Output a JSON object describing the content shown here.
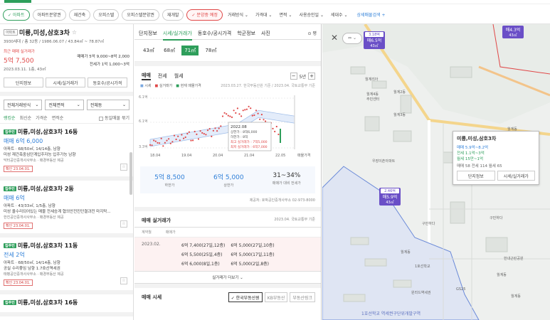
{
  "filters": {
    "items": [
      {
        "label": "✓ 아파트",
        "style": "green"
      },
      {
        "label": "아파트분양권",
        "style": ""
      },
      {
        "label": "재건축",
        "style": ""
      },
      {
        "label": "오피스텔",
        "style": ""
      },
      {
        "label": "오피스텔분양권",
        "style": ""
      },
      {
        "label": "재개발",
        "style": ""
      },
      {
        "label": "✓ 분양중 예정",
        "style": "red"
      },
      {
        "label": "거래방식 ⌄",
        "style": "plain"
      },
      {
        "label": "가격대 ⌄",
        "style": "plain"
      },
      {
        "label": "면적 ⌄",
        "style": "plain"
      },
      {
        "label": "사용승인일 ⌄",
        "style": "plain"
      },
      {
        "label": "세대수 ⌄",
        "style": "plain"
      },
      {
        "label": "상세매물검색 +",
        "style": "link"
      }
    ]
  },
  "complex": {
    "badge": "아파트",
    "name": "미륭,미성,삼호3차",
    "star": "☆",
    "meta": "3930세대 / 총 32동 / 1986.06.07 / 43.84㎡ ~ 78.87㎡",
    "recent_label": "최근 매매 실거래가",
    "recent_price": "5억 7,500",
    "recent_date": "2023.03.11. 1층, 43㎡",
    "sale_range": "매매가 5억 9,000~8억 2,000",
    "rent_range": "전세가 1억 1,000~3억",
    "btn_info": "단지정보",
    "btn_trade": "시세/실거래가",
    "btn_school": "동호수/공시가격"
  },
  "selects": {
    "trade": "전체거래방식",
    "area": "전체면적",
    "dong": "전체동"
  },
  "sort": {
    "items": [
      "랭킹순",
      "최신순",
      "가격순",
      "면적순"
    ],
    "same": "동일매물 묶기"
  },
  "listings": [
    {
      "tag": "집주인",
      "title": "미륭,미성,삼호3차 16동",
      "price": "매매 6억 6,000",
      "line1": "아파트 · 68/50㎡, 14/14층, 남향",
      "line2": "미성 재건축중심단계입주자능 입주가능 남향",
      "agent": "닥터공인중개사사무소 · 매경부동산 제공",
      "date": "확인 23.04.01."
    },
    {
      "tag": "집주인",
      "title": "미륭,미성,삼호3차 2동",
      "price": "매매 6억",
      "line1": "아파트 · 43/33㎡, 1/5층, 남향",
      "line2": "미성 올수리되어있는 매물 전세승계 협의안전진단결과전 마지막...",
      "agent": "한진공인중개사사무소 · 매경부동산 제공",
      "date": "확인 23.04.01."
    },
    {
      "tag": "집주인",
      "title": "미륭,미성,삼호3차 11동",
      "price": "전세 2억",
      "line1": "아파트 · 68/50㎡, 14/14층, 남향",
      "line2": "공실 수리좋임 남향 1.7호선역세권",
      "agent": "태평공인중개사사무소 · 매경부동산 제공",
      "date": "확인 23.04.01."
    },
    {
      "tag": "집주인",
      "title": "미륭,미성,삼호3차 16동",
      "price": "",
      "line1": "",
      "line2": "",
      "agent": "",
      "date": ""
    }
  ],
  "mid": {
    "tabs": [
      "단지정보",
      "시세/실거래가",
      "동호수/공시가격",
      "학군정보",
      "사진"
    ],
    "share": "⊙ 평",
    "areas": [
      "43㎡",
      "68㎡",
      "71㎡",
      "78㎡"
    ],
    "types": [
      "매매",
      "전세",
      "월세"
    ],
    "period": "5년",
    "legend": {
      "a": "시세",
      "b": "실거래가",
      "c": "현재 매물가격",
      "note": "2023.03.27. 한국부동산원 기준 / 2023.04. 국토교통부 기준"
    },
    "tooltip": {
      "date": "2022.08",
      "l1": "상한가 : 8억6,000",
      "l2": "하한가 : 8억",
      "l3": "최고 실거래가 : 7억5,000",
      "l4": "최저 실거래가 : 6억7,000"
    },
    "sale_label": "매물가격",
    "summary": {
      "low": "5억 8,500",
      "low_label": "하한가",
      "high": "6억 5,000",
      "high_label": "상한가",
      "ratio": "31~34%",
      "ratio_label": "매매가 대비 전세가"
    },
    "provider": "제공처: 호박공인중개사무소 02-973-8000",
    "trade_title": "매매 실거래가",
    "trade_note": "2023.04. 국토교통부 기준",
    "col1": "계약월",
    "col2": "매매가",
    "row_month": "2023.02.",
    "row_vals": [
      "6억 7,400(27일,12층)",
      "6억 5,000(27일,10층)",
      "6억 5,500(25일,4층)",
      "6억 5,000(17일,11층)",
      "6억 6,000(8일,1층)",
      "6억 5,000(2일,8층)"
    ],
    "more": "실거래가 더보기 ⌄",
    "market_title": "매매 시세",
    "src1": "✓ 한국부동산원",
    "src2": "KB부동산",
    "src3": "부동산링크"
  },
  "chart_data": {
    "type": "line",
    "ylabel_ticks": [
      "6.1억",
      "6.1억",
      "3.3억"
    ],
    "x_ticks": [
      "18.04",
      "19.04",
      "20.04",
      "21.04",
      "22.05"
    ],
    "series": [
      {
        "name": "시세"
      },
      {
        "name": "실거래가"
      },
      {
        "name": "현재 매물가격"
      }
    ]
  },
  "map": {
    "markers": [
      {
        "id": "m1",
        "top": "3.18억",
        "main": "매6.5억",
        "sub": "43㎡"
      },
      {
        "id": "m2",
        "top": "",
        "main": "매4.3억",
        "sub": "43㎡"
      },
      {
        "id": "m3",
        "top": "2.46억",
        "main": "매5.9억",
        "sub": "43㎡"
      }
    ],
    "popup": {
      "title": "미륭,미성,삼호3차",
      "l1": "매매 5.9억~8.2억",
      "l2": "전세 1.1억~3억",
      "l3": "월세 15만~1억",
      "counts": "매매 58  전세 114  월세 65",
      "b1": "단지정보",
      "b2": "시세/실거래가"
    },
    "labels": [
      "월계리아",
      "월계4동",
      "주민센터",
      "월계2동",
      "월계3동",
      "우장이촌아파트",
      "월계동",
      "GS25",
      "월계동",
      "구민하다",
      "한내근린공원",
      "1호선학교",
      "원라드역세권",
      "구민하다",
      "월계동",
      "월계동"
    ],
    "bottom_label": "1호선학교 역세권구단위개발구역"
  }
}
